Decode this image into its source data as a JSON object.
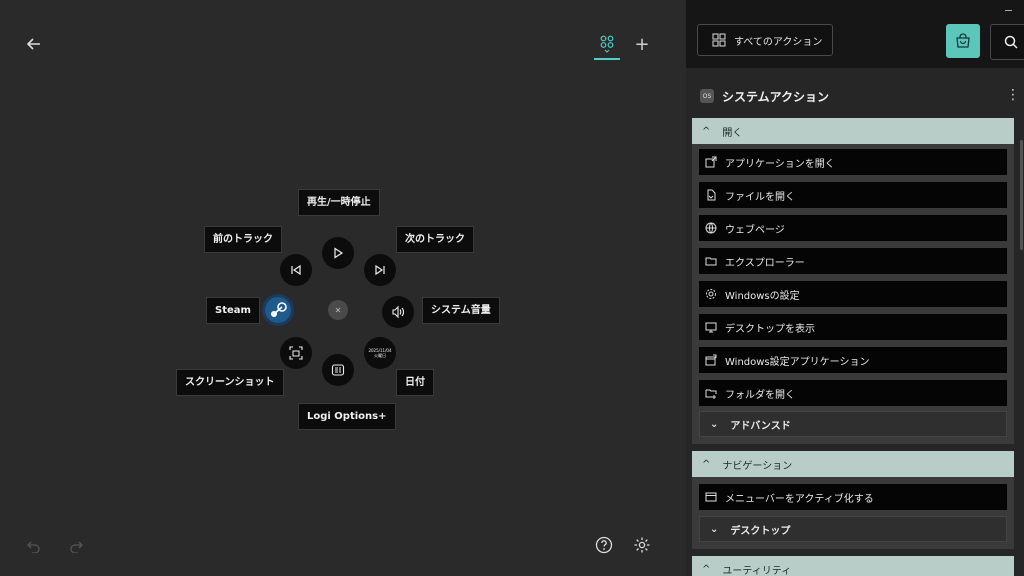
{
  "wheel": {
    "center_label": "✕",
    "actions": {
      "play_pause": "再生/一時停止",
      "prev_track": "前のトラック",
      "next_track": "次のトラック",
      "steam": "Steam",
      "system_volume": "システム音量",
      "screenshot": "スクリーンショット",
      "date": "日付",
      "logi_options": "Logi Options+"
    },
    "date_icon_line1": "2025/11/04",
    "date_icon_line2": "火曜日"
  },
  "sidebar": {
    "all_actions_label": "すべてのアクション",
    "category_badge": "OS",
    "category_title": "システムアクション",
    "sections": [
      {
        "title": "開く",
        "items": [
          "アプリケーションを開く",
          "ファイルを開く",
          "ウェブページ",
          "エクスプローラー",
          "Windowsの設定",
          "デスクトップを表示",
          "Windows設定アプリケーション",
          "フォルダを開く"
        ],
        "subgroup": "アドバンスド"
      },
      {
        "title": "ナビゲーション",
        "items": [
          "メニューバーをアクティブ化する"
        ],
        "subgroup": "デスクトップ"
      },
      {
        "title": "ユーティリティ"
      }
    ]
  },
  "colors": {
    "accent": "#4fd1c5",
    "section_header": "#b9cdc8",
    "store_button": "#5cc6bb"
  }
}
